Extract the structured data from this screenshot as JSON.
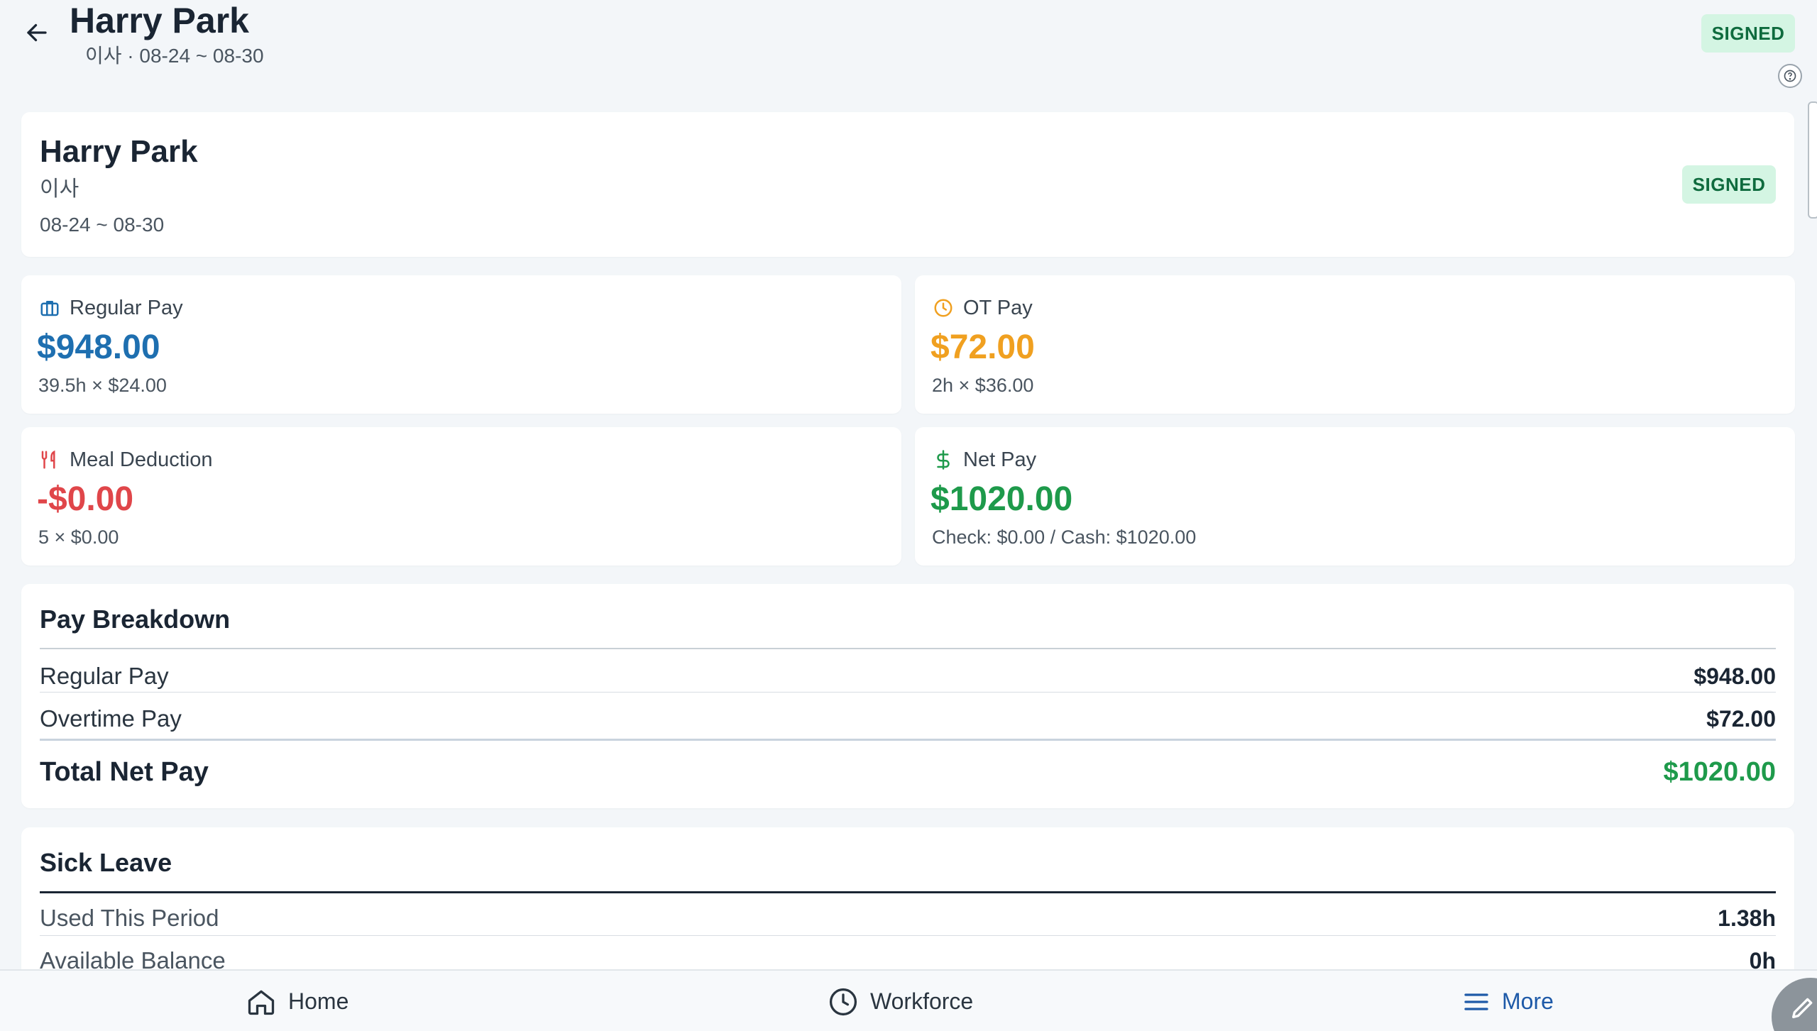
{
  "header": {
    "title": "Harry Park",
    "subtitle": "이사 · 08-24 ~ 08-30",
    "status": "SIGNED"
  },
  "employee": {
    "name": "Harry Park",
    "role": "이사",
    "period": "08-24 ~ 08-30",
    "status": "SIGNED"
  },
  "stats": {
    "regular": {
      "label": "Regular Pay",
      "value": "$948.00",
      "detail": "39.5h × $24.00",
      "color": "#1e6fb0"
    },
    "ot": {
      "label": "OT Pay",
      "value": "$72.00",
      "detail": "2h × $36.00",
      "color": "#f0a020"
    },
    "meal": {
      "label": "Meal Deduction",
      "value": "-$0.00",
      "detail": "5 × $0.00",
      "color": "#e0464a"
    },
    "net": {
      "label": "Net Pay",
      "value": "$1020.00",
      "detail": "Check: $0.00 / Cash: $1020.00",
      "color": "#1e9a4b"
    }
  },
  "breakdown": {
    "title": "Pay Breakdown",
    "rows": [
      {
        "label": "Regular Pay",
        "value": "$948.00"
      },
      {
        "label": "Overtime Pay",
        "value": "$72.00"
      }
    ],
    "total_label": "Total Net Pay",
    "total_value": "$1020.00"
  },
  "sick_leave": {
    "title": "Sick Leave",
    "rows": [
      {
        "label": "Used This Period",
        "value": "1.38h"
      },
      {
        "label": "Available Balance",
        "value": "0h"
      }
    ]
  },
  "nav": {
    "home": "Home",
    "workforce": "Workforce",
    "more": "More"
  },
  "icons": {
    "back": "arrow-left-icon",
    "regular": "briefcase-icon",
    "ot": "clock-icon",
    "meal": "utensils-icon",
    "net": "dollar-icon",
    "home": "home-icon",
    "workforce": "clock-icon",
    "more": "menu-icon",
    "fab": "pencil-icon",
    "help": "help-icon"
  }
}
